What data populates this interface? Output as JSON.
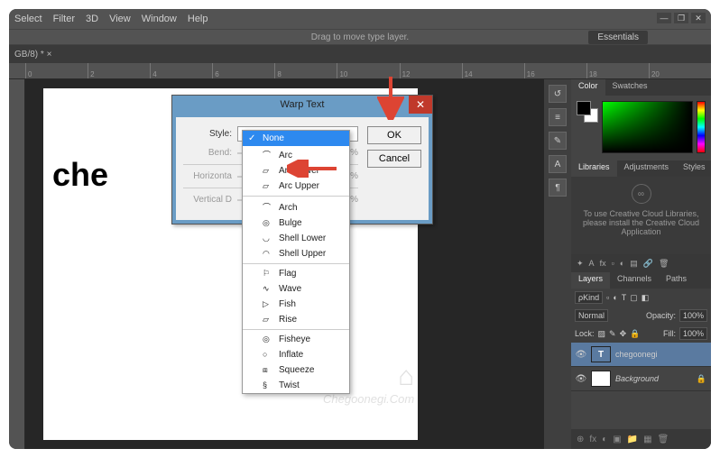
{
  "menu": {
    "items": [
      "Select",
      "Filter",
      "3D",
      "View",
      "Window",
      "Help"
    ]
  },
  "toolbar": {
    "message": "Drag to move type layer."
  },
  "workspace": {
    "label": "Essentials"
  },
  "tab": {
    "label": "GB/8) * ×"
  },
  "canvas": {
    "text": "che"
  },
  "dialog": {
    "title": "Warp Text",
    "style_label": "Style:",
    "style_value": "None",
    "bend_label": "Bend:",
    "horiz_label": "Horizonta",
    "vert_label": "Vertical D",
    "pct": "%",
    "ok": "OK",
    "cancel": "Cancel"
  },
  "dropdown": {
    "items": [
      {
        "label": "None",
        "selected": true
      },
      {
        "label": "Arc",
        "glyph": "⌒"
      },
      {
        "label": "Arc Lower",
        "glyph": "▱"
      },
      {
        "label": "Arc Upper",
        "glyph": "▱"
      },
      {
        "sep": true
      },
      {
        "label": "Arch",
        "glyph": "⌒"
      },
      {
        "label": "Bulge",
        "glyph": "◎"
      },
      {
        "label": "Shell Lower",
        "glyph": "◡"
      },
      {
        "label": "Shell Upper",
        "glyph": "◠"
      },
      {
        "sep": true
      },
      {
        "label": "Flag",
        "glyph": "⚐"
      },
      {
        "label": "Wave",
        "glyph": "∿"
      },
      {
        "label": "Fish",
        "glyph": "▷"
      },
      {
        "label": "Rise",
        "glyph": "▱"
      },
      {
        "sep": true
      },
      {
        "label": "Fisheye",
        "glyph": "◎"
      },
      {
        "label": "Inflate",
        "glyph": "○"
      },
      {
        "label": "Squeeze",
        "glyph": "⧈"
      },
      {
        "label": "Twist",
        "glyph": "§"
      }
    ]
  },
  "panels": {
    "color_tab": "Color",
    "swatches_tab": "Swatches",
    "libraries_tab": "Libraries",
    "adjustments_tab": "Adjustments",
    "styles_tab": "Styles",
    "cc_message": "To use Creative Cloud Libraries, please install the Creative Cloud Application",
    "layers_tab": "Layers",
    "channels_tab": "Channels",
    "paths_tab": "Paths",
    "kind_label": "ρKind",
    "blend_mode": "Normal",
    "opacity_label": "Opacity:",
    "opacity_value": "100%",
    "lock_label": "Lock:",
    "fill_label": "Fill:",
    "fill_value": "100%",
    "layer1": {
      "name": "chegoonegi",
      "type": "T"
    },
    "layer2": {
      "name": "Background"
    }
  },
  "watermark": {
    "text": "Chegoonegi.Com"
  },
  "ruler_marks": [
    "0",
    "2",
    "4",
    "6",
    "8",
    "10",
    "12",
    "14",
    "16",
    "18",
    "20"
  ]
}
